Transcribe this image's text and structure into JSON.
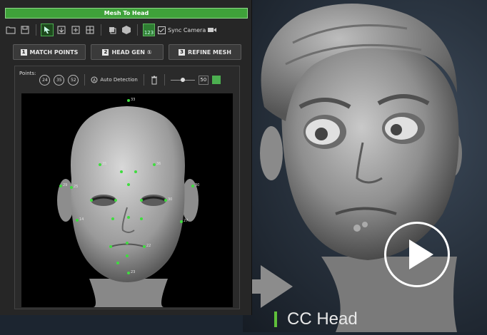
{
  "window": {
    "title": "Mesh To Head"
  },
  "toolbar": {
    "sync_label": "Sync Camera",
    "badge": "123"
  },
  "steps": [
    {
      "num": "1",
      "label": "MATCH POINTS"
    },
    {
      "num": "2",
      "label": "HEAD GEN ①"
    },
    {
      "num": "3",
      "label": "REFINE MESH"
    }
  ],
  "points": {
    "label": "Points:",
    "options": [
      "24",
      "35",
      "52"
    ],
    "auto_label": "Auto Detection",
    "size_value": "50",
    "swatch_color": "#4caf50"
  },
  "landmarks": [
    "33",
    "35",
    "36",
    "29",
    "30",
    "14",
    "27",
    "25",
    "30",
    "22",
    "23"
  ],
  "caption": {
    "text": "CC Head",
    "accent": "#5fbf3a"
  }
}
